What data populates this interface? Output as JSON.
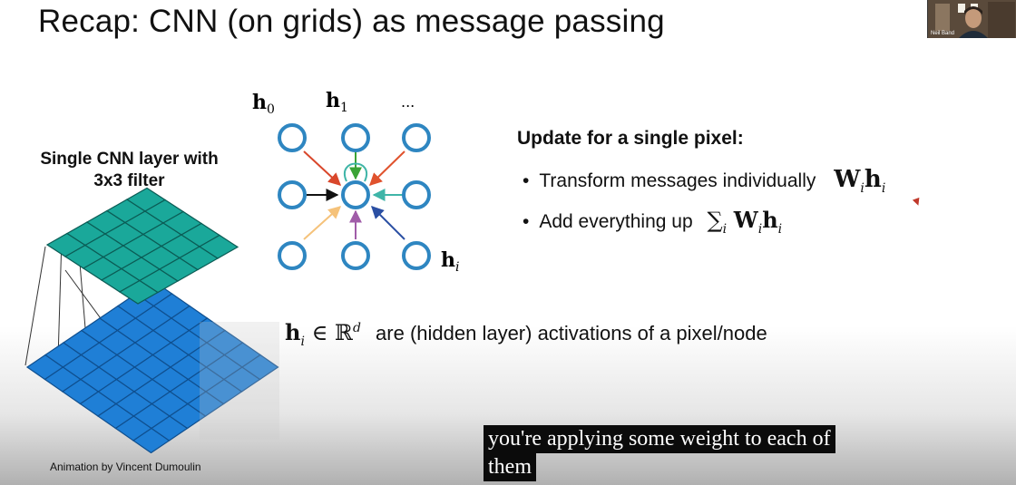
{
  "slide": {
    "title": "Recap: CNN (on grids) as message passing",
    "left_caption_line1": "Single CNN layer with",
    "left_caption_line2": "3x3 filter",
    "credit": "Animation by Vincent Dumoulin",
    "graph_labels": {
      "h0": "h",
      "h0_sub": "0",
      "h1": "h",
      "h1_sub": "1",
      "ellipsis": "...",
      "hi": "h",
      "hi_sub": "i"
    },
    "update_heading": "Update for a single pixel:",
    "bullets": [
      {
        "text": "Transform messages individually",
        "math": "W",
        "math_sub": "i",
        "math2": "h",
        "math2_sub": "i"
      },
      {
        "text": "Add everything up",
        "sum": "∑",
        "sum_sub": "i",
        "math": "W",
        "math_sub": "i",
        "math2": "h",
        "math2_sub": "i"
      }
    ],
    "activation": {
      "math_h": "h",
      "math_sub": "i",
      "in_symbol": "∈",
      "real": "ℝ",
      "real_sup": "d",
      "text": "are (hidden layer) activations of a pixel/node"
    }
  },
  "webcam": {
    "label": "Neil Band"
  },
  "subtitles": {
    "line1": "you're applying some weight to each of",
    "line2": "them"
  },
  "colors": {
    "node_stroke": "#2e86c1",
    "top_grid": "#1aa89a",
    "bottom_grid": "#1f7fd6",
    "arrow_red": "#d9472b",
    "arrow_green": "#3aa335",
    "arrow_orange": "#f5c27a",
    "arrow_purple": "#a05ca8",
    "arrow_blue": "#2b4fa3",
    "arrow_teal": "#3fb5a8",
    "arrow_black": "#111111"
  }
}
